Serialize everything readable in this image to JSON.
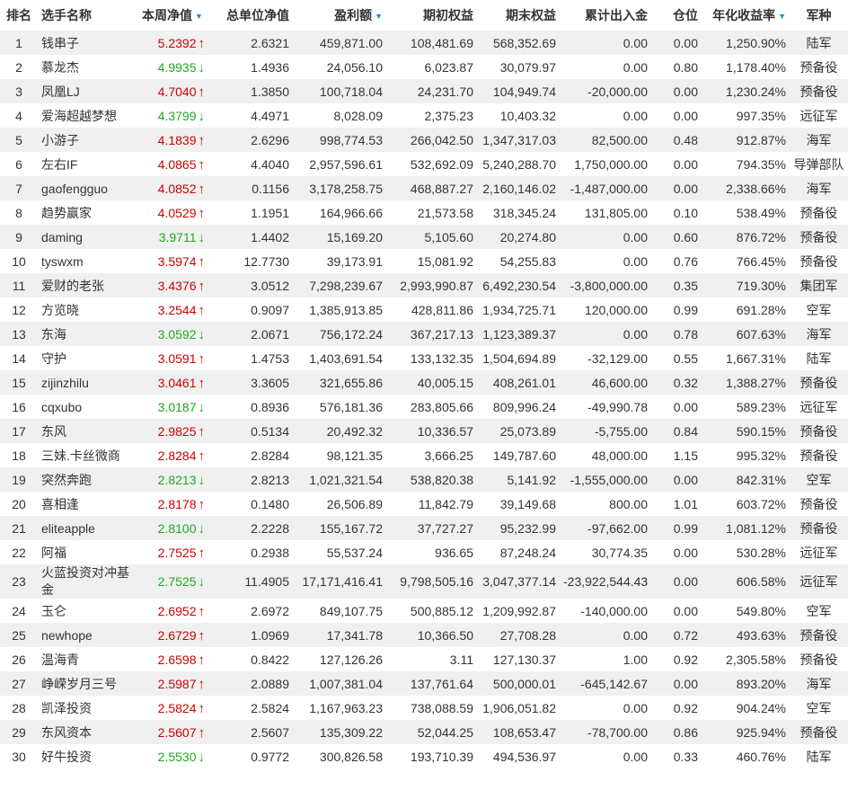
{
  "headers": {
    "rank": "排名",
    "name": "选手名称",
    "weekly_nav": "本周净值",
    "total_nav": "总单位净值",
    "profit": "盈利额",
    "start_equity": "期初权益",
    "end_equity": "期末权益",
    "net_flow": "累计出入金",
    "position": "仓位",
    "annual_return": "年化收益率",
    "army": "军种"
  },
  "icons": {
    "sort": "sort-caret-down-icon",
    "up": "arrow-up-icon",
    "down": "arrow-down-icon"
  },
  "colors": {
    "up": "#cc0000",
    "down": "#1fa81f",
    "sort": "#1a8fd8",
    "stripe": "#f0f0f0"
  },
  "rows": [
    {
      "rank": "1",
      "name": "钱串子",
      "nav": "5.2392",
      "dir": "up",
      "total_nav": "2.6321",
      "profit": "459,871.00",
      "start": "108,481.69",
      "end": "568,352.69",
      "flow": "0.00",
      "position": "0.00",
      "annual": "1,250.90%",
      "army": "陆军"
    },
    {
      "rank": "2",
      "name": "慕龙杰",
      "nav": "4.9935",
      "dir": "down",
      "total_nav": "1.4936",
      "profit": "24,056.10",
      "start": "6,023.87",
      "end": "30,079.97",
      "flow": "0.00",
      "position": "0.80",
      "annual": "1,178.40%",
      "army": "预备役"
    },
    {
      "rank": "3",
      "name": "凤凰LJ",
      "nav": "4.7040",
      "dir": "up",
      "total_nav": "1.3850",
      "profit": "100,718.04",
      "start": "24,231.70",
      "end": "104,949.74",
      "flow": "-20,000.00",
      "position": "0.00",
      "annual": "1,230.24%",
      "army": "预备役"
    },
    {
      "rank": "4",
      "name": "爱海超越梦想",
      "nav": "4.3799",
      "dir": "down",
      "total_nav": "4.4971",
      "profit": "8,028.09",
      "start": "2,375.23",
      "end": "10,403.32",
      "flow": "0.00",
      "position": "0.00",
      "annual": "997.35%",
      "army": "远征军"
    },
    {
      "rank": "5",
      "name": "小游子",
      "nav": "4.1839",
      "dir": "up",
      "total_nav": "2.6296",
      "profit": "998,774.53",
      "start": "266,042.50",
      "end": "1,347,317.03",
      "flow": "82,500.00",
      "position": "0.48",
      "annual": "912.87%",
      "army": "海军"
    },
    {
      "rank": "6",
      "name": "左右IF",
      "nav": "4.0865",
      "dir": "up",
      "total_nav": "4.4040",
      "profit": "2,957,596.61",
      "start": "532,692.09",
      "end": "5,240,288.70",
      "flow": "1,750,000.00",
      "position": "0.00",
      "annual": "794.35%",
      "army": "导弹部队"
    },
    {
      "rank": "7",
      "name": "gaofengguo",
      "nav": "4.0852",
      "dir": "up",
      "total_nav": "0.1156",
      "profit": "3,178,258.75",
      "start": "468,887.27",
      "end": "2,160,146.02",
      "flow": "-1,487,000.00",
      "position": "0.00",
      "annual": "2,338.66%",
      "army": "海军"
    },
    {
      "rank": "8",
      "name": "趋势赢家",
      "nav": "4.0529",
      "dir": "up",
      "total_nav": "1.1951",
      "profit": "164,966.66",
      "start": "21,573.58",
      "end": "318,345.24",
      "flow": "131,805.00",
      "position": "0.10",
      "annual": "538.49%",
      "army": "预备役"
    },
    {
      "rank": "9",
      "name": "daming",
      "nav": "3.9711",
      "dir": "down",
      "total_nav": "1.4402",
      "profit": "15,169.20",
      "start": "5,105.60",
      "end": "20,274.80",
      "flow": "0.00",
      "position": "0.60",
      "annual": "876.72%",
      "army": "预备役"
    },
    {
      "rank": "10",
      "name": "tyswxm",
      "nav": "3.5974",
      "dir": "up",
      "total_nav": "12.7730",
      "profit": "39,173.91",
      "start": "15,081.92",
      "end": "54,255.83",
      "flow": "0.00",
      "position": "0.76",
      "annual": "766.45%",
      "army": "预备役"
    },
    {
      "rank": "11",
      "name": "爱财的老张",
      "nav": "3.4376",
      "dir": "up",
      "total_nav": "3.0512",
      "profit": "7,298,239.67",
      "start": "2,993,990.87",
      "end": "6,492,230.54",
      "flow": "-3,800,000.00",
      "position": "0.35",
      "annual": "719.30%",
      "army": "集团军"
    },
    {
      "rank": "12",
      "name": "方览晓",
      "nav": "3.2544",
      "dir": "up",
      "total_nav": "0.9097",
      "profit": "1,385,913.85",
      "start": "428,811.86",
      "end": "1,934,725.71",
      "flow": "120,000.00",
      "position": "0.99",
      "annual": "691.28%",
      "army": "空军"
    },
    {
      "rank": "13",
      "name": "东海",
      "nav": "3.0592",
      "dir": "down",
      "total_nav": "2.0671",
      "profit": "756,172.24",
      "start": "367,217.13",
      "end": "1,123,389.37",
      "flow": "0.00",
      "position": "0.78",
      "annual": "607.63%",
      "army": "海军"
    },
    {
      "rank": "14",
      "name": "守护",
      "nav": "3.0591",
      "dir": "up",
      "total_nav": "1.4753",
      "profit": "1,403,691.54",
      "start": "133,132.35",
      "end": "1,504,694.89",
      "flow": "-32,129.00",
      "position": "0.55",
      "annual": "1,667.31%",
      "army": "陆军"
    },
    {
      "rank": "15",
      "name": "zijinzhilu",
      "nav": "3.0461",
      "dir": "up",
      "total_nav": "3.3605",
      "profit": "321,655.86",
      "start": "40,005.15",
      "end": "408,261.01",
      "flow": "46,600.00",
      "position": "0.32",
      "annual": "1,388.27%",
      "army": "预备役"
    },
    {
      "rank": "16",
      "name": "cqxubo",
      "nav": "3.0187",
      "dir": "down",
      "total_nav": "0.8936",
      "profit": "576,181.36",
      "start": "283,805.66",
      "end": "809,996.24",
      "flow": "-49,990.78",
      "position": "0.00",
      "annual": "589.23%",
      "army": "远征军"
    },
    {
      "rank": "17",
      "name": "东风",
      "nav": "2.9825",
      "dir": "up",
      "total_nav": "0.5134",
      "profit": "20,492.32",
      "start": "10,336.57",
      "end": "25,073.89",
      "flow": "-5,755.00",
      "position": "0.84",
      "annual": "590.15%",
      "army": "预备役"
    },
    {
      "rank": "18",
      "name": "三妹.卡丝微商",
      "nav": "2.8284",
      "dir": "up",
      "total_nav": "2.8284",
      "profit": "98,121.35",
      "start": "3,666.25",
      "end": "149,787.60",
      "flow": "48,000.00",
      "position": "1.15",
      "annual": "995.32%",
      "army": "预备役"
    },
    {
      "rank": "19",
      "name": "突然奔跑",
      "nav": "2.8213",
      "dir": "down",
      "total_nav": "2.8213",
      "profit": "1,021,321.54",
      "start": "538,820.38",
      "end": "5,141.92",
      "flow": "-1,555,000.00",
      "position": "0.00",
      "annual": "842.31%",
      "army": "空军"
    },
    {
      "rank": "20",
      "name": "喜相逢",
      "nav": "2.8178",
      "dir": "up",
      "total_nav": "0.1480",
      "profit": "26,506.89",
      "start": "11,842.79",
      "end": "39,149.68",
      "flow": "800.00",
      "position": "1.01",
      "annual": "603.72%",
      "army": "预备役"
    },
    {
      "rank": "21",
      "name": "eliteapple",
      "nav": "2.8100",
      "dir": "down",
      "total_nav": "2.2228",
      "profit": "155,167.72",
      "start": "37,727.27",
      "end": "95,232.99",
      "flow": "-97,662.00",
      "position": "0.99",
      "annual": "1,081.12%",
      "army": "预备役"
    },
    {
      "rank": "22",
      "name": "阿福",
      "nav": "2.7525",
      "dir": "up",
      "total_nav": "0.2938",
      "profit": "55,537.24",
      "start": "936.65",
      "end": "87,248.24",
      "flow": "30,774.35",
      "position": "0.00",
      "annual": "530.28%",
      "army": "远征军"
    },
    {
      "rank": "23",
      "name": "火蓝投资对冲基金",
      "nav": "2.7525",
      "dir": "down",
      "total_nav": "11.4905",
      "profit": "17,171,416.41",
      "start": "9,798,505.16",
      "end": "3,047,377.14",
      "flow": "-23,922,544.43",
      "position": "0.00",
      "annual": "606.58%",
      "army": "远征军",
      "tall": true
    },
    {
      "rank": "24",
      "name": "玉仑",
      "nav": "2.6952",
      "dir": "up",
      "total_nav": "2.6972",
      "profit": "849,107.75",
      "start": "500,885.12",
      "end": "1,209,992.87",
      "flow": "-140,000.00",
      "position": "0.00",
      "annual": "549.80%",
      "army": "空军"
    },
    {
      "rank": "25",
      "name": "newhope",
      "nav": "2.6729",
      "dir": "up",
      "total_nav": "1.0969",
      "profit": "17,341.78",
      "start": "10,366.50",
      "end": "27,708.28",
      "flow": "0.00",
      "position": "0.72",
      "annual": "493.63%",
      "army": "预备役"
    },
    {
      "rank": "26",
      "name": "温海青",
      "nav": "2.6598",
      "dir": "up",
      "total_nav": "0.8422",
      "profit": "127,126.26",
      "start": "3.11",
      "end": "127,130.37",
      "flow": "1.00",
      "position": "0.92",
      "annual": "2,305.58%",
      "army": "预备役"
    },
    {
      "rank": "27",
      "name": "峥嵘岁月三号",
      "nav": "2.5987",
      "dir": "up",
      "total_nav": "2.0889",
      "profit": "1,007,381.04",
      "start": "137,761.64",
      "end": "500,000.01",
      "flow": "-645,142.67",
      "position": "0.00",
      "annual": "893.20%",
      "army": "海军"
    },
    {
      "rank": "28",
      "name": "凯泽投资",
      "nav": "2.5824",
      "dir": "up",
      "total_nav": "2.5824",
      "profit": "1,167,963.23",
      "start": "738,088.59",
      "end": "1,906,051.82",
      "flow": "0.00",
      "position": "0.92",
      "annual": "904.24%",
      "army": "空军"
    },
    {
      "rank": "29",
      "name": "东风资本",
      "nav": "2.5607",
      "dir": "up",
      "total_nav": "2.5607",
      "profit": "135,309.22",
      "start": "52,044.25",
      "end": "108,653.47",
      "flow": "-78,700.00",
      "position": "0.86",
      "annual": "925.94%",
      "army": "预备役"
    },
    {
      "rank": "30",
      "name": "好牛投资",
      "nav": "2.5530",
      "dir": "down",
      "total_nav": "0.9772",
      "profit": "300,826.58",
      "start": "193,710.39",
      "end": "494,536.97",
      "flow": "0.00",
      "position": "0.33",
      "annual": "460.76%",
      "army": "陆军"
    }
  ]
}
